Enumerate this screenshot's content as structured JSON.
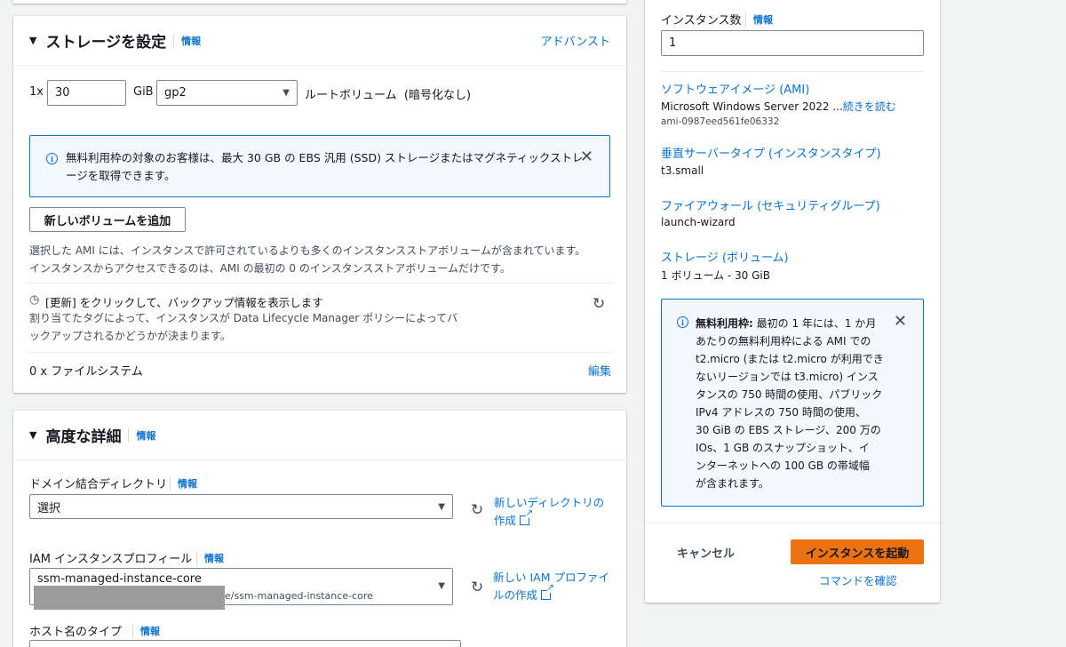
{
  "storage": {
    "title": "ストレージを設定",
    "info": "情報",
    "advanced": "アドバンスト",
    "count_prefix": "1x",
    "size_value": "30",
    "unit": "GiB",
    "volume_type": "gp2",
    "volume_desc": "ルートボリューム  (暗号化なし)",
    "alert_line1": "無料利用枠の対象のお客様は、最大 30 GB の EBS 汎用 (SSD) ストレージまたはマグネティックストレ",
    "alert_line2": "ージを取得できます。",
    "add_volume": "新しいボリュームを追加",
    "note_line1": "選択した AMI には、インスタンスで許可されているよりも多くのインスタンスストアボリュームが含まれています。",
    "note_line2": "インスタンスからアクセスできるのは、AMI の最初の 0 のインスタンスストアボリュームだけです。",
    "backup_title": "[更新] をクリックして、バックアップ情報を表示します",
    "backup_line1": "割り当てたタグによって、インスタンスが Data Lifecycle Manager ポリシーによってバ",
    "backup_line2": "ックアップされるかどうかが決まります。",
    "filesystem": "0 x ファイルシステム",
    "edit": "編集"
  },
  "advanced": {
    "title": "高度な詳細",
    "info": "情報",
    "domain_label": "ドメイン結合ディレクトリ",
    "domain_value": "選択",
    "new_dir_line1": "新しいディレクトリの",
    "new_dir_line2": "作成",
    "iam_label": "IAM インスタンスプロフィール",
    "iam_value": "ssm-managed-instance-core",
    "iam_arn": "e/ssm-managed-instance-core",
    "new_iam_line1": "新しい IAM プロファイ",
    "new_iam_line2": "ルの作成",
    "host_label": "ホスト名のタイプ"
  },
  "summary": {
    "count_label": "インスタンス数",
    "info": "情報",
    "count_value": "1",
    "ami_label": "ソフトウェアイメージ (AMI)",
    "ami_value": "Microsoft Windows Server 2022 ...",
    "read_more": "続きを読む",
    "ami_id": "ami-0987eed561fe06332",
    "type_label": "垂直サーバータイプ (インスタンスタイプ)",
    "type_value": "t3.small",
    "fw_label": "ファイアウォール (セキュリティグループ)",
    "fw_value": "launch-wizard",
    "storage_label": "ストレージ (ボリューム)",
    "storage_value": "1 ボリューム - 30 GiB",
    "free_bold": "無料利用枠:",
    "free_l1": " 最初の 1 年には、1 か月",
    "free_l2": "あたりの無料利用枠による AMI での",
    "free_l3": "t2.micro (または t2.micro が利用でき",
    "free_l4": "ないリージョンでは t3.micro) インス",
    "free_l5": "タンスの 750 時間の使用、パブリック",
    "free_l6": "IPv4 アドレスの 750 時間の使用、",
    "free_l7": "30 GiB の EBS ストレージ、200 万の",
    "free_l8": "IOs、1 GB のスナップショット、イ",
    "free_l9": "ンターネットへの 100 GB の帯域幅",
    "free_l10": "が含まれます。",
    "cancel": "キャンセル",
    "launch": "インスタンスを起動",
    "confirm": "コマンドを確認"
  },
  "colors": {
    "accent": "#0972d3",
    "primary": "#ec7211",
    "alert_bg": "#f2f8fd"
  }
}
